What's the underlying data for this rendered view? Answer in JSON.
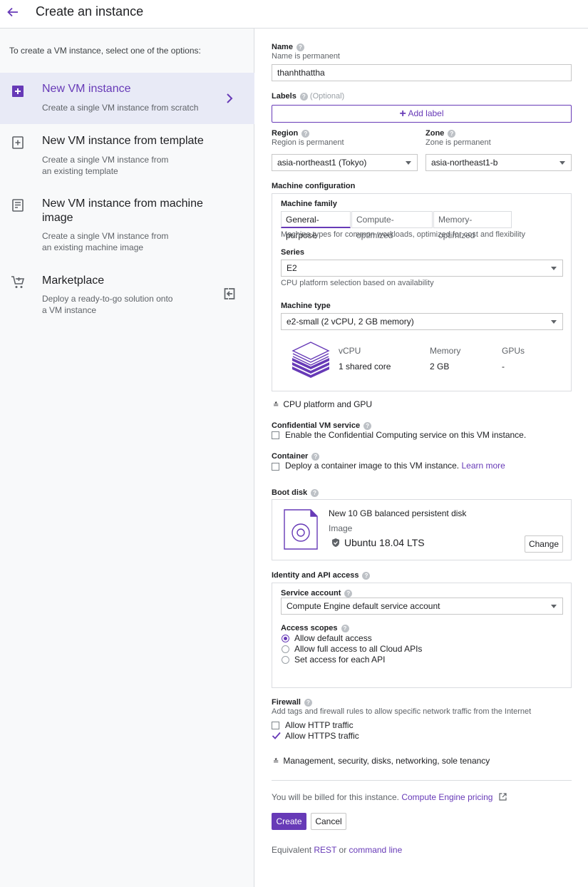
{
  "header": {
    "title": "Create an instance"
  },
  "sidebar": {
    "intro": "To create a VM instance, select one of the options:",
    "options": [
      {
        "title": "New VM instance",
        "desc": "Create a single VM instance from scratch"
      },
      {
        "title": "New VM instance from template",
        "desc": "Create a single VM instance from an existing template"
      },
      {
        "title": "New VM instance from machine image",
        "desc": "Create a single VM instance from an existing machine image"
      },
      {
        "title": "Marketplace",
        "desc": "Deploy a ready-to-go solution onto a VM instance"
      }
    ]
  },
  "form": {
    "name": {
      "label": "Name",
      "hint": "Name is permanent",
      "value": "thanhthattha"
    },
    "labels": {
      "label": "Labels",
      "optional": "(Optional)",
      "add": "Add label"
    },
    "region": {
      "label": "Region",
      "hint": "Region is permanent",
      "value": "asia-northeast1 (Tokyo)"
    },
    "zone": {
      "label": "Zone",
      "hint": "Zone is permanent",
      "value": "asia-northeast1-b"
    },
    "machine": {
      "section": "Machine configuration",
      "family_label": "Machine family",
      "tabs": [
        "General-purpose",
        "Compute-optimized",
        "Memory-optimized"
      ],
      "family_hint": "Machine types for common workloads, optimized for cost and flexibility",
      "series_label": "Series",
      "series_value": "E2",
      "series_hint": "CPU platform selection based on availability",
      "type_label": "Machine type",
      "type_value": "e2-small (2 vCPU, 2 GB memory)",
      "spec_headers": [
        "vCPU",
        "Memory",
        "GPUs"
      ],
      "spec_values": [
        "1 shared core",
        "2 GB",
        "-"
      ]
    },
    "cpu_platform_link": "CPU platform and GPU",
    "confidential": {
      "label": "Confidential VM service",
      "option": "Enable the Confidential Computing service on this VM instance."
    },
    "container": {
      "label": "Container",
      "option": "Deploy a container image to this VM instance.",
      "learn_more": "Learn more"
    },
    "boot_disk": {
      "label": "Boot disk",
      "title": "New 10 GB balanced persistent disk",
      "image_label": "Image",
      "image_value": "Ubuntu 18.04 LTS",
      "change": "Change"
    },
    "identity": {
      "label": "Identity and API access",
      "service_account_label": "Service account",
      "service_account_value": "Compute Engine default service account",
      "scopes_label": "Access scopes",
      "scopes": [
        "Allow default access",
        "Allow full access to all Cloud APIs",
        "Set access for each API"
      ]
    },
    "firewall": {
      "label": "Firewall",
      "hint": "Add tags and firewall rules to allow specific network traffic from the Internet",
      "http": "Allow HTTP traffic",
      "https": "Allow HTTPS traffic"
    },
    "management_link": "Management, security, disks, networking, sole tenancy",
    "billing": {
      "text": "You will be billed for this instance.",
      "link": "Compute Engine pricing"
    },
    "create": "Create",
    "cancel": "Cancel",
    "equivalent": {
      "prefix": "Equivalent",
      "rest": "REST",
      "or": "or",
      "cmd": "command line"
    }
  },
  "colors": {
    "accent": "#673ab7",
    "link": "#1a73e8"
  }
}
